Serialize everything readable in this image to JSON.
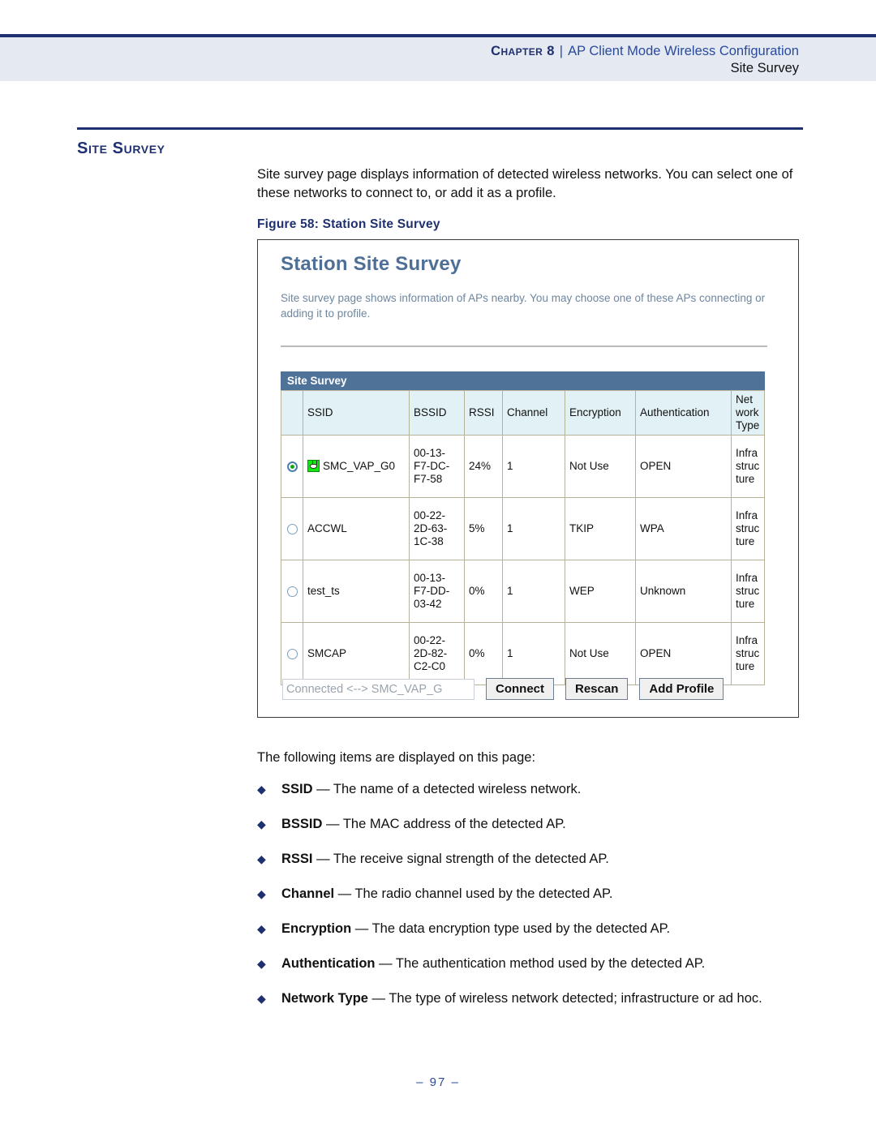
{
  "header": {
    "chapter_label": "Chapter 8",
    "separator": "|",
    "chapter_title": "AP Client Mode Wireless Configuration",
    "sub_title": "Site Survey"
  },
  "section": {
    "title": "Site Survey",
    "intro": "Site survey page displays information of detected wireless networks. You can select one of these networks to connect to, or add it as a profile.",
    "figure_caption": "Figure 58:  Station Site Survey"
  },
  "screenshot": {
    "app_title": "Station Site Survey",
    "app_description": "Site survey page shows information of APs nearby. You may choose one of these APs connecting or adding it to profile.",
    "panel_title": "Site Survey",
    "columns": [
      "",
      "SSID",
      "BSSID",
      "RSSI",
      "Channel",
      "Encryption",
      "Authentication",
      "Network Type"
    ],
    "rows": [
      {
        "selected": true,
        "has_icon": true,
        "ssid": "SMC_VAP_G0",
        "bssid": "00-13-F7-DC-F7-58",
        "rssi": "24%",
        "channel": "1",
        "encryption": "Not Use",
        "authentication": "OPEN",
        "network_type": "Infrastructure"
      },
      {
        "selected": false,
        "has_icon": false,
        "ssid": "ACCWL",
        "bssid": "00-22-2D-63-1C-38",
        "rssi": "5%",
        "channel": "1",
        "encryption": "TKIP",
        "authentication": "WPA",
        "network_type": "Infrastructure"
      },
      {
        "selected": false,
        "has_icon": false,
        "ssid": "test_ts",
        "bssid": "00-13-F7-DD-03-42",
        "rssi": "0%",
        "channel": "1",
        "encryption": "WEP",
        "authentication": "Unknown",
        "network_type": "Infrastructure"
      },
      {
        "selected": false,
        "has_icon": false,
        "ssid": "SMCAP",
        "bssid": "00-22-2D-82-C2-C0",
        "rssi": "0%",
        "channel": "1",
        "encryption": "Not Use",
        "authentication": "OPEN",
        "network_type": "Infrastructure"
      }
    ],
    "status_value": "Connected <--> SMC_VAP_G",
    "buttons": {
      "connect": "Connect",
      "rescan": "Rescan",
      "add_profile": "Add Profile"
    },
    "icon_name": "ap-signal-icon",
    "colors": {
      "panel_bar": "#4f7299",
      "title": "#4e6f96",
      "header_cell": "#e2f1f6",
      "radio_selected_dot": "#1aa318"
    }
  },
  "items": {
    "lead_in": "The following items are displayed on this page:",
    "bullet_glyph": "◆",
    "entries": [
      {
        "term": "SSID",
        "dash": " — ",
        "desc": "The name of a detected wireless network."
      },
      {
        "term": "BSSID",
        "dash": " — ",
        "desc": "The MAC address of the detected AP."
      },
      {
        "term": "RSSI",
        "dash": " — ",
        "desc": "The receive signal strength of the detected AP."
      },
      {
        "term": "Channel",
        "dash": " — ",
        "desc": "The radio channel used by the detected AP."
      },
      {
        "term": "Encryption",
        "dash": " — ",
        "desc": "The data encryption type used by the detected AP."
      },
      {
        "term": "Authentication",
        "dash": " — ",
        "desc": "The authentication method used by the detected AP."
      },
      {
        "term": "Network Type",
        "dash": " — ",
        "desc": "The type of wireless network detected; infrastructure or ad hoc."
      }
    ]
  },
  "footer": {
    "page_number": "–  97  –"
  },
  "theme": {
    "navy": "#1f3070",
    "header_band": "#e4e9f2",
    "link_blue": "#2b4a9b"
  }
}
